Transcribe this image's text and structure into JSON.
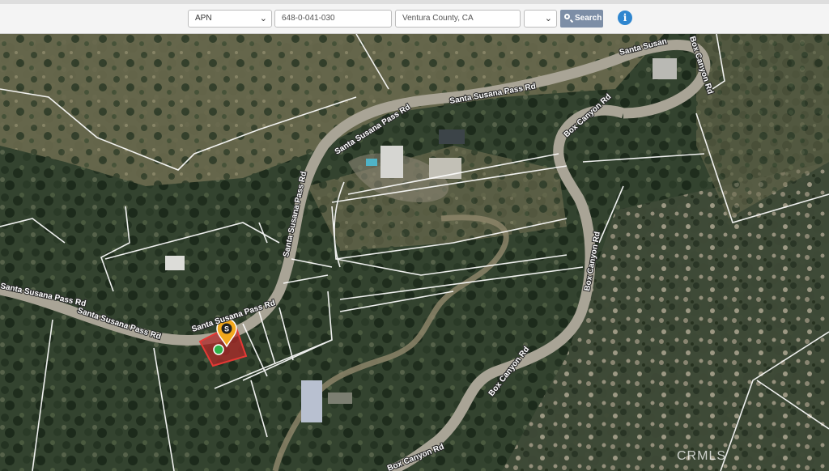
{
  "search": {
    "type_value": "APN",
    "apn_value": "648-0-041-030",
    "location_value": "Ventura County, CA",
    "extra_select_value": "",
    "search_label": "Search"
  },
  "map": {
    "roads": [
      {
        "label": "Santa Susana Pass Rd"
      },
      {
        "label": "Santa Susana Pass Rd"
      },
      {
        "label": "Santa Susana Pass Rd"
      },
      {
        "label": "Santa Susana Pass Rd"
      },
      {
        "label": "Santa Susan"
      },
      {
        "label": "Box Canyon Rd"
      },
      {
        "label": "Box Canyon Rd"
      },
      {
        "label": "Box Canyon Rd"
      },
      {
        "label": "Box Canyon Rd"
      },
      {
        "label": "Box Canyon Rd"
      }
    ],
    "marker_label": "S",
    "parcel_color": "#c0392b",
    "watermark": "CRMLS"
  },
  "colors": {
    "accent": "#2f86cf",
    "button": "#7d8ea6"
  }
}
